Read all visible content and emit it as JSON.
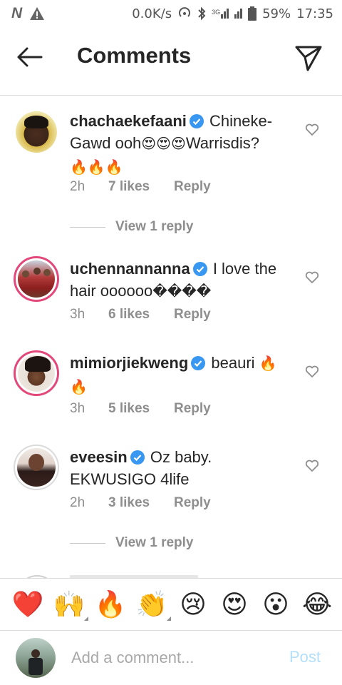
{
  "status_bar": {
    "network_speed": "0.0K/s",
    "battery": "59%",
    "time": "17:35",
    "net_type": "3G"
  },
  "header": {
    "title": "Comments"
  },
  "comments": [
    {
      "username": "chachaekefaani",
      "text": "Chineke-Gawd ooh",
      "text_after_emoji": "Warrisdis?",
      "emoji_1": "😍😍😍",
      "emoji_2": "🔥🔥🔥",
      "time": "2h",
      "likes": "7 likes",
      "reply": "Reply",
      "view_replies": "View 1 reply"
    },
    {
      "username": "uchennannanna",
      "text": "I love the hair oooooo",
      "emoji_1": "����",
      "time": "3h",
      "likes": "6 likes",
      "reply": "Reply"
    },
    {
      "username": "mimiorjiekweng",
      "text": "beauri",
      "emoji_1": "🔥",
      "emoji_2": "🔥",
      "time": "3h",
      "likes": "5 likes",
      "reply": "Reply"
    },
    {
      "username": "eveesin",
      "text": "Oz baby. EKWUSIGO 4life",
      "time": "2h",
      "likes": "3 likes",
      "reply": "Reply",
      "view_replies": "View 1 reply"
    }
  ],
  "emoji_bar": [
    "❤️",
    "🙌",
    "🔥",
    "👏",
    "😢",
    "😍",
    "😮",
    "😂"
  ],
  "compose": {
    "placeholder": "Add a comment...",
    "post_label": "Post"
  },
  "colors": {
    "verified_blue": "#3897f0",
    "story_ring": "#e2497a",
    "post_disabled": "#b2dffc",
    "meta_gray": "#8e8e8e"
  }
}
